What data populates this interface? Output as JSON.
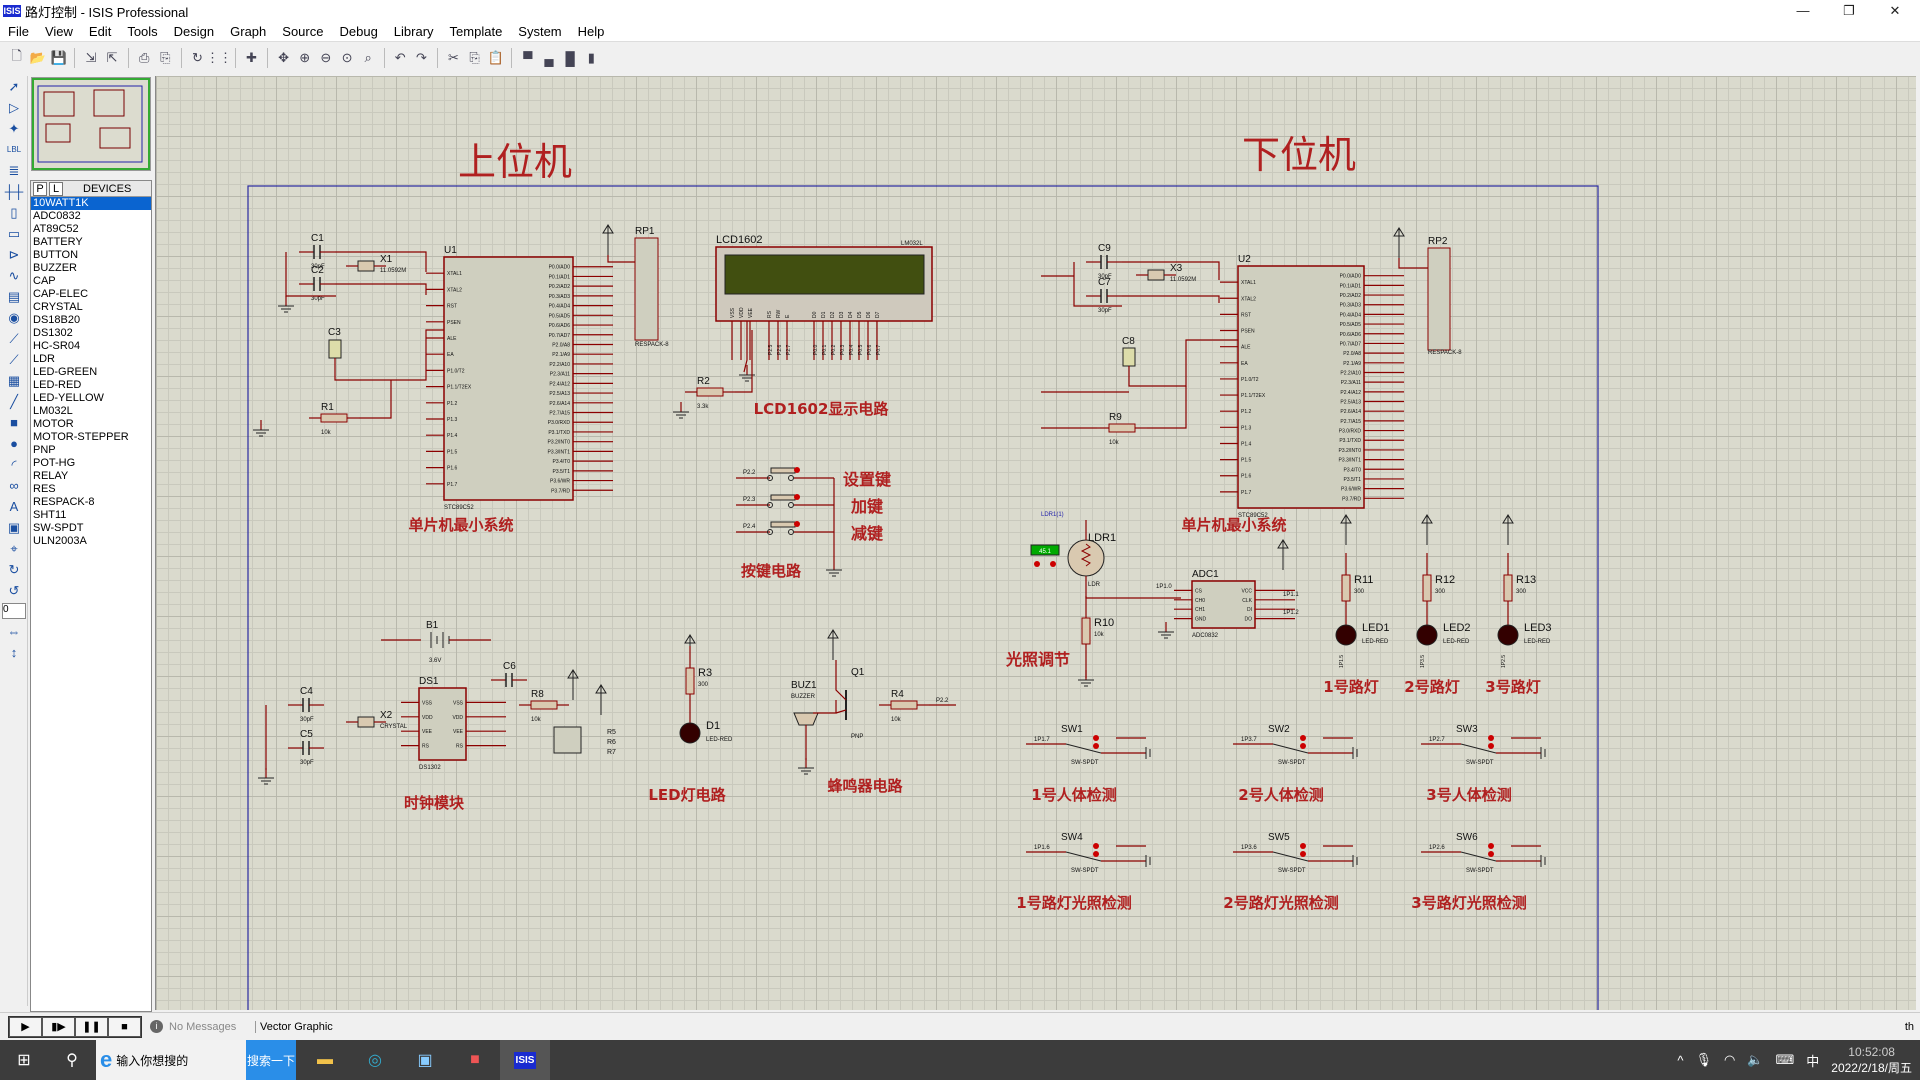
{
  "window": {
    "title": "路灯控制 - ISIS Professional",
    "logo_text": "ISIS",
    "controls": [
      "—",
      "❐",
      "✕"
    ]
  },
  "menu": [
    "File",
    "View",
    "Edit",
    "Tools",
    "Design",
    "Graph",
    "Source",
    "Debug",
    "Library",
    "Template",
    "System",
    "Help"
  ],
  "toolbar": {
    "icons": [
      "new-icon",
      "open-icon",
      "save-icon",
      "import-icon",
      "export-icon",
      "print-icon",
      "print-area-icon",
      "refresh-icon",
      "grid-icon",
      "origin-icon",
      "pan-icon",
      "zoom-in-icon",
      "zoom-out-icon",
      "zoom-all-icon",
      "zoom-area-icon",
      "undo-icon",
      "redo-icon",
      "cut-icon",
      "copy-icon",
      "paste-icon",
      "block-copy-icon",
      "block-move-icon",
      "block-rotate-icon",
      "block-delete-icon"
    ]
  },
  "left_tools": [
    "select-icon",
    "component-icon",
    "junction-icon",
    "label-icon",
    "text-script-icon",
    "bus-icon",
    "subcircuit-icon",
    "terminal-icon",
    "pin-icon",
    "graph-icon",
    "tape-icon",
    "generator-icon",
    "voltage-probe-icon",
    "current-probe-icon",
    "instrument-icon",
    "line-icon",
    "box-icon",
    "circle-icon",
    "arc-icon",
    "path-icon",
    "text-icon",
    "symbol-icon",
    "marker-icon",
    "rotate-cw-icon",
    "rotate-ccw-icon",
    "flip-h-icon",
    "flip-v-icon"
  ],
  "rotation_value": "0",
  "devices": {
    "tab_p": "P",
    "tab_l": "L",
    "header": "DEVICES",
    "selected": "10WATT1K",
    "items": [
      "10WATT1K",
      "ADC0832",
      "AT89C52",
      "BATTERY",
      "BUTTON",
      "BUZZER",
      "CAP",
      "CAP-ELEC",
      "CRYSTAL",
      "DS18B20",
      "DS1302",
      "HC-SR04",
      "LDR",
      "LED-GREEN",
      "LED-RED",
      "LED-YELLOW",
      "LM032L",
      "MOTOR",
      "MOTOR-STEPPER",
      "PNP",
      "POT-HG",
      "RELAY",
      "RES",
      "RESPACK-8",
      "SHT11",
      "SW-SPDT",
      "ULN2003A"
    ]
  },
  "schematic": {
    "titles": {
      "upper": "上位机",
      "lower": "下位机"
    },
    "section_labels": {
      "mcu_left": "单片机最小系统",
      "lcd": "LCD1602显示电路",
      "btn_set": "设置键",
      "btn_add": "加键",
      "btn_sub": "减键",
      "buttons": "按键电路",
      "mcu_right": "单片机最小系统",
      "light_adjust": "光照调节",
      "lamp1": "1号路灯",
      "lamp2": "2号路灯",
      "lamp3": "3号路灯",
      "clock": "时钟模块",
      "led": "LED灯电路",
      "buzzer": "蜂鸣器电路",
      "pir1": "1号人体检测",
      "pir2": "2号人体检测",
      "pir3": "3号人体检测",
      "ls1": "1号路灯光照检测",
      "ls2": "2号路灯光照检测",
      "ls3": "3号路灯光照检测"
    },
    "mcu_part": "STC89C52",
    "mcu_left_pins": [
      "XTAL1",
      "XTAL2",
      "RST",
      "PSEN",
      "ALE",
      "EA",
      "P1.0/T2",
      "P1.1/T2EX",
      "P1.2",
      "P1.3",
      "P1.4",
      "P1.5",
      "P1.6",
      "P1.7"
    ],
    "mcu_right_pins": [
      "P0.0/AD0",
      "P0.1/AD1",
      "P0.2/AD2",
      "P0.3/AD3",
      "P0.4/AD4",
      "P0.5/AD5",
      "P0.6/AD6",
      "P0.7/AD7",
      "P2.0/A8",
      "P2.1/A9",
      "P2.2/A10",
      "P2.3/A11",
      "P2.4/A12",
      "P2.5/A13",
      "P2.6/A14",
      "P2.7/A15",
      "P3.0/RXD",
      "P3.1/TXD",
      "P3.2/INT0",
      "P3.3/INT1",
      "P3.4/T0",
      "P3.5/T1",
      "P3.6/WR",
      "P3.7/RD"
    ],
    "lcd": {
      "name": "LCD1602",
      "part": "LM032L",
      "pins": [
        "VSS",
        "VDD",
        "VEE",
        "RS",
        "RW",
        "E",
        "D0",
        "D1",
        "D2",
        "D3",
        "D4",
        "D5",
        "D6",
        "D7"
      ],
      "nets": [
        "P2.5",
        "P2.6",
        "P2.7",
        "P0.0",
        "P0.1",
        "P0.2",
        "P0.3",
        "P0.4",
        "P0.5",
        "P0.6",
        "P0.7"
      ]
    },
    "buttons": [
      "P2.2",
      "P2.3",
      "P2.4"
    ],
    "adc": {
      "name": "ADC1",
      "part": "ADC0832",
      "left_pins": [
        "CS",
        "CH0",
        "CH1",
        "GND"
      ],
      "right_pins": [
        "VCC",
        "CLK",
        "DI",
        "DO"
      ],
      "nets": [
        "1P1.0",
        "1P1.1",
        "1P1.2"
      ]
    },
    "ldr": {
      "name": "LDR1",
      "part": "LDR",
      "probe": "LDR1(1)",
      "meter": "45.1"
    },
    "components": {
      "U1": "U1",
      "U2": "U2",
      "C1": "C1",
      "C2": "C2",
      "C3": "C3",
      "X1": "X1",
      "R1": "R1",
      "RP1": "RP1",
      "R2": "R2",
      "C9": "C9",
      "C7": "C7",
      "X3": "X3",
      "C8": "C8",
      "R9": "R9",
      "RP2": "RP2",
      "R10": "R10",
      "R11": "R11",
      "R12": "R12",
      "R13": "R13",
      "LED1": "LED1",
      "LED2": "LED2",
      "LED3": "LED3",
      "B1": "B1",
      "C4": "C4",
      "C5": "C5",
      "X2": "X2",
      "DS1": "DS1",
      "C6": "C6",
      "R8": "R8",
      "R5": "R5",
      "R6": "R6",
      "R7": "R7",
      "R3": "R3",
      "D1": "D1",
      "BUZ1": "BUZ1",
      "Q1": "Q1",
      "R4": "R4",
      "SW1": "SW1",
      "SW2": "SW2",
      "SW3": "SW3",
      "SW4": "SW4",
      "SW5": "SW5",
      "SW6": "SW6"
    },
    "values": {
      "cap_small": "30pF",
      "crystal": "11.0592M",
      "res10k": "10k",
      "res300": "300",
      "res2": "3.3k",
      "respack": "RESPACK-8",
      "led_red": "LED-RED",
      "sw": "SW-SPDT",
      "buzzer": "BUZZER",
      "pnp": "PNP",
      "ds": "DS1302",
      "crystal2": "CRYSTAL",
      "bat": "3.6V"
    },
    "lamp_nets": [
      "1P1.5",
      "1P3.5",
      "1P2.5"
    ],
    "sw_nets": [
      "1P1.7",
      "1P3.7",
      "1P2.7",
      "1P1.6",
      "1P3.6",
      "1P2.6"
    ],
    "wire_color": "#8b0000",
    "label_color": "#b02020",
    "frame_color": "#2a2aa0"
  },
  "statusbar": {
    "messages": "No Messages",
    "mode": "Vector Graphic",
    "right": "th"
  },
  "taskbar": {
    "search_placeholder": "输入你想搜的",
    "search_button": "搜索一下",
    "tray_ime": "中",
    "time": "10:52:08",
    "date": "2022/2/18/周五"
  }
}
